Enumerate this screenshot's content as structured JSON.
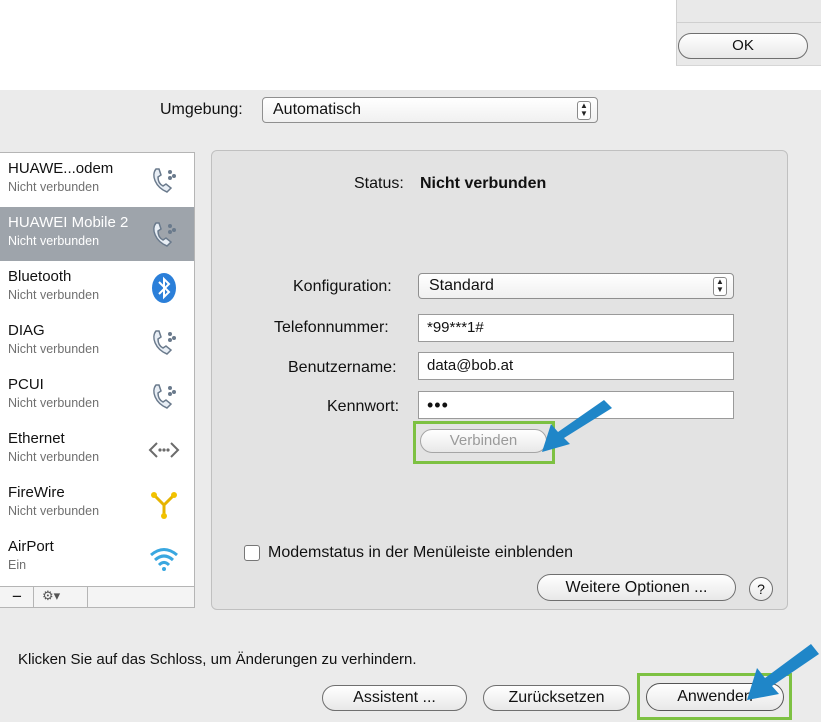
{
  "top_dialog": {
    "ok_label": "OK"
  },
  "location": {
    "label": "Umgebung:",
    "value": "Automatisch"
  },
  "services": [
    {
      "name": "HUAWE...odem",
      "status": "Nicht verbunden",
      "icon": "phone-icon"
    },
    {
      "name": "HUAWEI Mobile 2",
      "status": "Nicht verbunden",
      "icon": "phone-icon"
    },
    {
      "name": "Bluetooth",
      "status": "Nicht verbunden",
      "icon": "bluetooth-icon"
    },
    {
      "name": "DIAG",
      "status": "Nicht verbunden",
      "icon": "phone-icon"
    },
    {
      "name": "PCUI",
      "status": "Nicht verbunden",
      "icon": "phone-icon"
    },
    {
      "name": "Ethernet",
      "status": "Nicht verbunden",
      "icon": "ethernet-icon"
    },
    {
      "name": "FireWire",
      "status": "Nicht verbunden",
      "icon": "firewire-icon"
    },
    {
      "name": "AirPort",
      "status": "Ein",
      "icon": "wifi-icon"
    }
  ],
  "sidebar_tools": {
    "remove": "−",
    "gear": "⚙▾"
  },
  "panel": {
    "status_label": "Status:",
    "status_value": "Nicht verbunden",
    "config_label": "Konfiguration:",
    "config_value": "Standard",
    "phone_label": "Telefonnummer:",
    "phone_value": "*99***1#",
    "user_label": "Benutzername:",
    "user_value": "data@bob.at",
    "password_label": "Kennwort:",
    "password_value": "•••",
    "connect_label": "Verbinden",
    "modem_status_label": "Modemstatus in der Menüleiste einblenden",
    "more_options_label": "Weitere Optionen ...",
    "help_label": "?"
  },
  "footer": {
    "lock_text": "Klicken Sie auf das Schloss, um Änderungen zu verhindern.",
    "assistant_label": "Assistent ...",
    "revert_label": "Zurücksetzen",
    "apply_label": "Anwenden"
  },
  "colors": {
    "highlight_green": "#7dc142",
    "arrow_blue": "#1f86c8",
    "selection": "#9ea4ab"
  }
}
